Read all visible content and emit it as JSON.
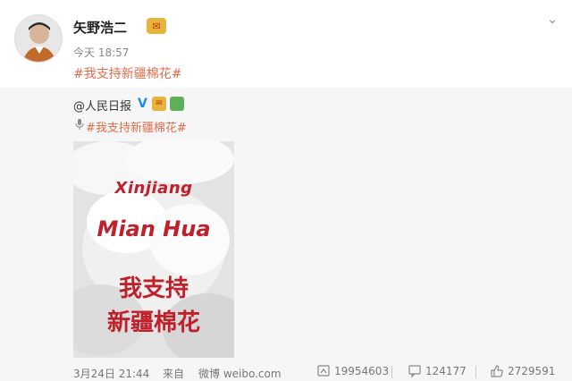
{
  "post": {
    "author": "矢野浩二",
    "time": "今天 18:57",
    "text": "#我支持新疆棉花#",
    "repost": {
      "author": "@人民日报",
      "text": "#我支持新疆棉花#",
      "poster": {
        "line1": "Xinjiang",
        "line2": "Mian Hua",
        "line3": "我支持",
        "line4": "新疆棉花"
      },
      "footer": {
        "date": "3月24日 21:44",
        "from": "来自",
        "source": "微博 weibo.com",
        "reposts": "19954603",
        "comments": "124177",
        "likes": "2729591"
      }
    }
  }
}
